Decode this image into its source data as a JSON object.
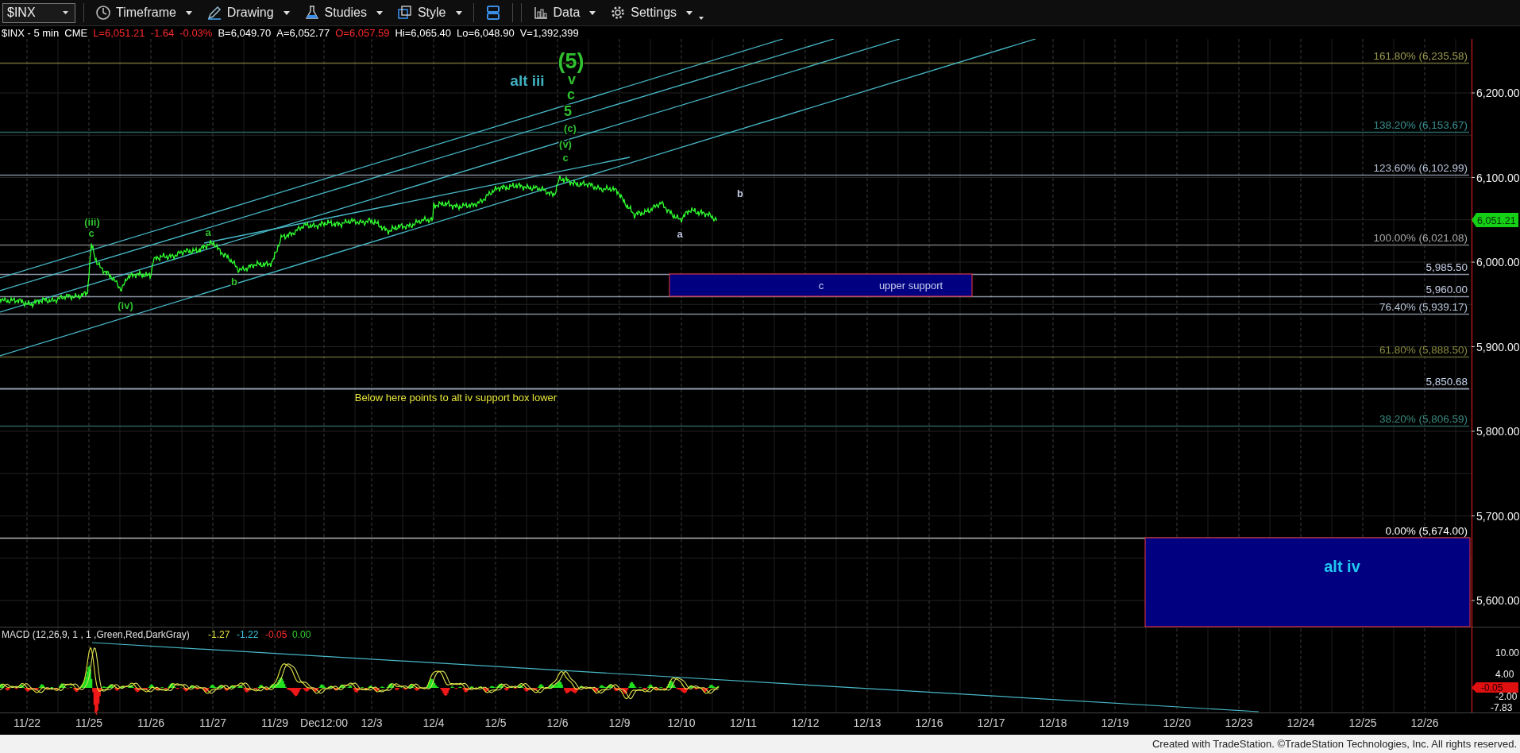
{
  "toolbar": {
    "symbol": "$INX",
    "items": [
      {
        "kind": "timeframe",
        "label": "Timeframe"
      },
      {
        "kind": "drawing",
        "label": "Drawing"
      },
      {
        "kind": "studies",
        "label": "Studies"
      },
      {
        "kind": "style",
        "label": "Style"
      },
      {
        "kind": "layout"
      },
      {
        "kind": "data",
        "label": "Data"
      },
      {
        "kind": "settings",
        "label": "Settings"
      }
    ]
  },
  "quote_line": [
    {
      "text": "$INX - 5 min",
      "color": "#ffffff"
    },
    {
      "text": "CME",
      "color": "#ffffff"
    },
    {
      "text": "L=6,051.21",
      "color": "#ff2a2a"
    },
    {
      "text": "-1.64",
      "color": "#ff2a2a"
    },
    {
      "text": "-0.03%",
      "color": "#ff2a2a"
    },
    {
      "text": "B=6,049.70",
      "color": "#ffffff"
    },
    {
      "text": "A=6,052.77",
      "color": "#ffffff"
    },
    {
      "text": "O=6,057.59",
      "color": "#ff2a2a"
    },
    {
      "text": "Hi=6,065.40",
      "color": "#ffffff"
    },
    {
      "text": "Lo=6,048.90",
      "color": "#ffffff"
    },
    {
      "text": "V=1,392,399",
      "color": "#ffffff"
    }
  ],
  "price_axis": {
    "ticks": [
      "6,200.00",
      "6,100.00",
      "6,000.00",
      "5,900.00",
      "5,800.00",
      "5,700.00",
      "5,600.00"
    ],
    "last_price": "6,051.21"
  },
  "levels": [
    {
      "label": "161.80% (6,235.58)",
      "color": "#9a9a50"
    },
    {
      "label": "138.20% (6,153.67)",
      "color": "#3a9090"
    },
    {
      "label": "123.60% (6,102.99)",
      "color": "#b8c4d8"
    },
    {
      "label": "100.00% (6,021.08)",
      "color": "#a8a8a8"
    },
    {
      "label": "5,985.50",
      "color": "#c8d0e8"
    },
    {
      "label": "5,960.00",
      "color": "#c8d0e8"
    },
    {
      "label": "76.40% (5,939.17)",
      "color": "#b8c4d8"
    },
    {
      "label": "61.80% (5,888.50)",
      "color": "#8a8a40"
    },
    {
      "label": "5,850.68",
      "color": "#c8d8f0"
    },
    {
      "label": "38.20% (5,806.59)",
      "color": "#3a8a80"
    },
    {
      "label": "0.00% (5,674.00)",
      "color": "#ffffff"
    }
  ],
  "zones": [
    {
      "labels": [
        "c",
        "upper support"
      ]
    },
    {
      "labels": [
        "alt iv"
      ]
    }
  ],
  "wave_labels": [
    {
      "text": "(5)",
      "color": "#30c030"
    },
    {
      "text": "alt iii",
      "color": "#40b0c0"
    },
    {
      "text": "v",
      "color": "#30c030"
    },
    {
      "text": "c",
      "color": "#30c030"
    },
    {
      "text": "5",
      "color": "#30c030"
    },
    {
      "text": "(c)",
      "color": "#30c030"
    },
    {
      "text": "(v)",
      "color": "#30c030"
    },
    {
      "text": "c",
      "color": "#30c030"
    },
    {
      "text": "(iii)",
      "color": "#30c030"
    },
    {
      "text": "c",
      "color": "#30c030"
    },
    {
      "text": "(iv)",
      "color": "#30c030"
    },
    {
      "text": "a",
      "color": "#30c030"
    },
    {
      "text": "b",
      "color": "#30c030"
    },
    {
      "text": "a",
      "color": "#c0c8e0"
    },
    {
      "text": "b",
      "color": "#c0c8e0"
    }
  ],
  "note": "Below here points to alt iv support box lower",
  "macd": {
    "title": "MACD (12,26,9, 1 , 1 ,Green,Red,DarkGray)",
    "values": [
      {
        "text": "-1.27",
        "color": "#e0e040"
      },
      {
        "text": "-1.22",
        "color": "#40c0e0"
      },
      {
        "text": "-0.05",
        "color": "#ff3030"
      },
      {
        "text": "0.00",
        "color": "#30d030"
      }
    ],
    "ticks": [
      "10.00",
      "4.00",
      "-2.00",
      "-7.83"
    ],
    "last_value": "-0.05"
  },
  "date_axis": [
    "11/22",
    "11/25",
    "11/26",
    "11/27",
    "11/29",
    "Dec12:00",
    "12/3",
    "12/4",
    "12/5",
    "12/6",
    "12/9",
    "12/10",
    "12/11",
    "12/12",
    "12/13",
    "12/16",
    "12/17",
    "12/18",
    "12/19",
    "12/20",
    "12/23",
    "12/24",
    "12/25",
    "12/26"
  ],
  "footer": "Created with TradeStation. ©TradeStation Technologies, Inc. All rights reserved."
}
